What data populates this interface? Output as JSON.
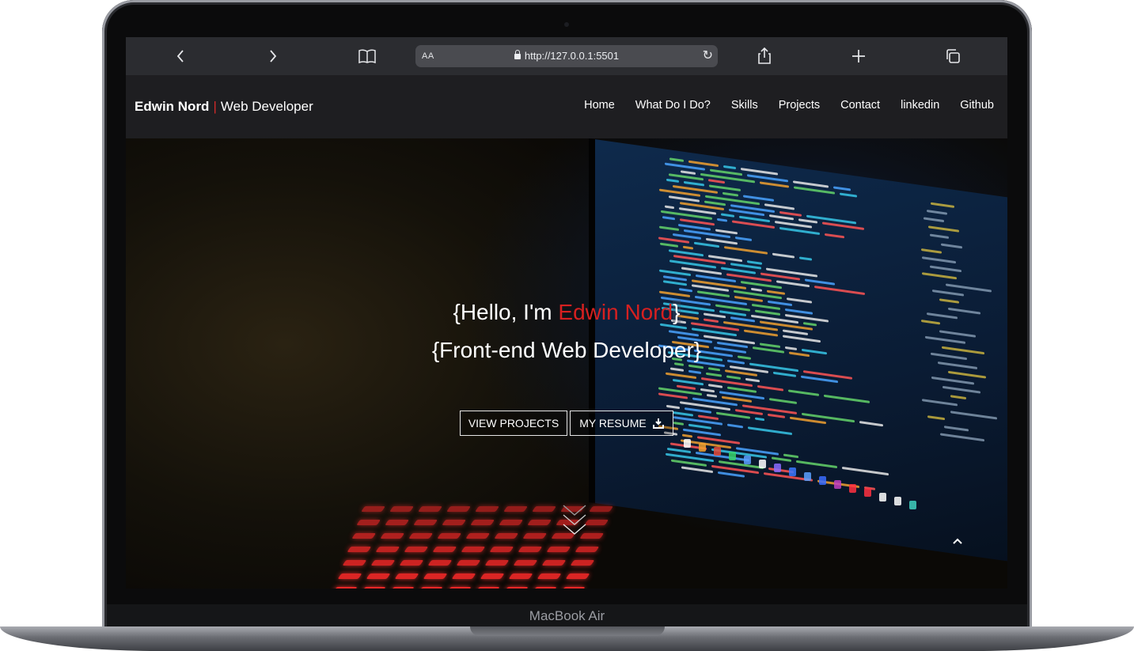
{
  "device": {
    "label": "MacBook Air"
  },
  "browser": {
    "text_size_label": "AA",
    "url": "http://127.0.0.1:5501",
    "icons": [
      "back-icon",
      "forward-icon",
      "bookmarks-icon",
      "lock-icon",
      "reload-icon",
      "share-icon",
      "new-tab-icon",
      "tabs-icon"
    ]
  },
  "site": {
    "brand": {
      "name": "Edwin Nord",
      "separator": "|",
      "role": "Web Developer"
    },
    "nav": [
      {
        "label": "Home"
      },
      {
        "label": "What Do I Do?"
      },
      {
        "label": "Skills"
      },
      {
        "label": "Projects"
      },
      {
        "label": "Contact"
      },
      {
        "label": "linkedin"
      },
      {
        "label": "Github"
      }
    ],
    "hero": {
      "line1_prefix": "{Hello, I'm ",
      "line1_name": "Edwin Nord",
      "line1_suffix": "}",
      "line2": "{Front-end Web Developer}",
      "buttons": {
        "projects": "VIEW PROJECTS",
        "resume": "MY RESUME"
      },
      "icons": [
        "download-icon",
        "scroll-down-icon",
        "back-to-top-icon"
      ]
    }
  },
  "colors": {
    "accent": "#d62020",
    "navbar": "#1e1e21",
    "toolbar": "#2b2c30"
  }
}
